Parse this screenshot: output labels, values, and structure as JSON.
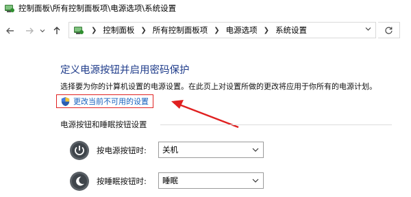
{
  "window": {
    "title": "控制面板\\所有控制面板项\\电源选项\\系统设置"
  },
  "address_bar": {
    "breadcrumbs": [
      "控制面板",
      "所有控制面板项",
      "电源选项",
      "系统设置"
    ]
  },
  "nav": {
    "back_icon": "arrow-left-icon",
    "forward_icon": "arrow-right-icon",
    "recent_icon": "chevron-down-icon",
    "up_icon": "arrow-up-icon",
    "refresh_icon": "refresh-icon"
  },
  "main": {
    "heading": "定义电源按钮并启用密码保护",
    "description": "选择要为你的计算机设置的电源设置。在此页上对设置所做的更改将应用于你所有的电源计划。",
    "change_link": "更改当前不可用的设置",
    "section_title": "电源按钮和睡眠按钮设置",
    "rows": [
      {
        "label": "按电源按钮时:",
        "value": "关机",
        "icon": "power-button-icon"
      },
      {
        "label": "按睡眠按钮时:",
        "value": "睡眠",
        "icon": "sleep-button-icon"
      }
    ]
  },
  "colors": {
    "heading": "#1e3b8a",
    "link": "#1560bd",
    "highlight": "#e02020"
  }
}
